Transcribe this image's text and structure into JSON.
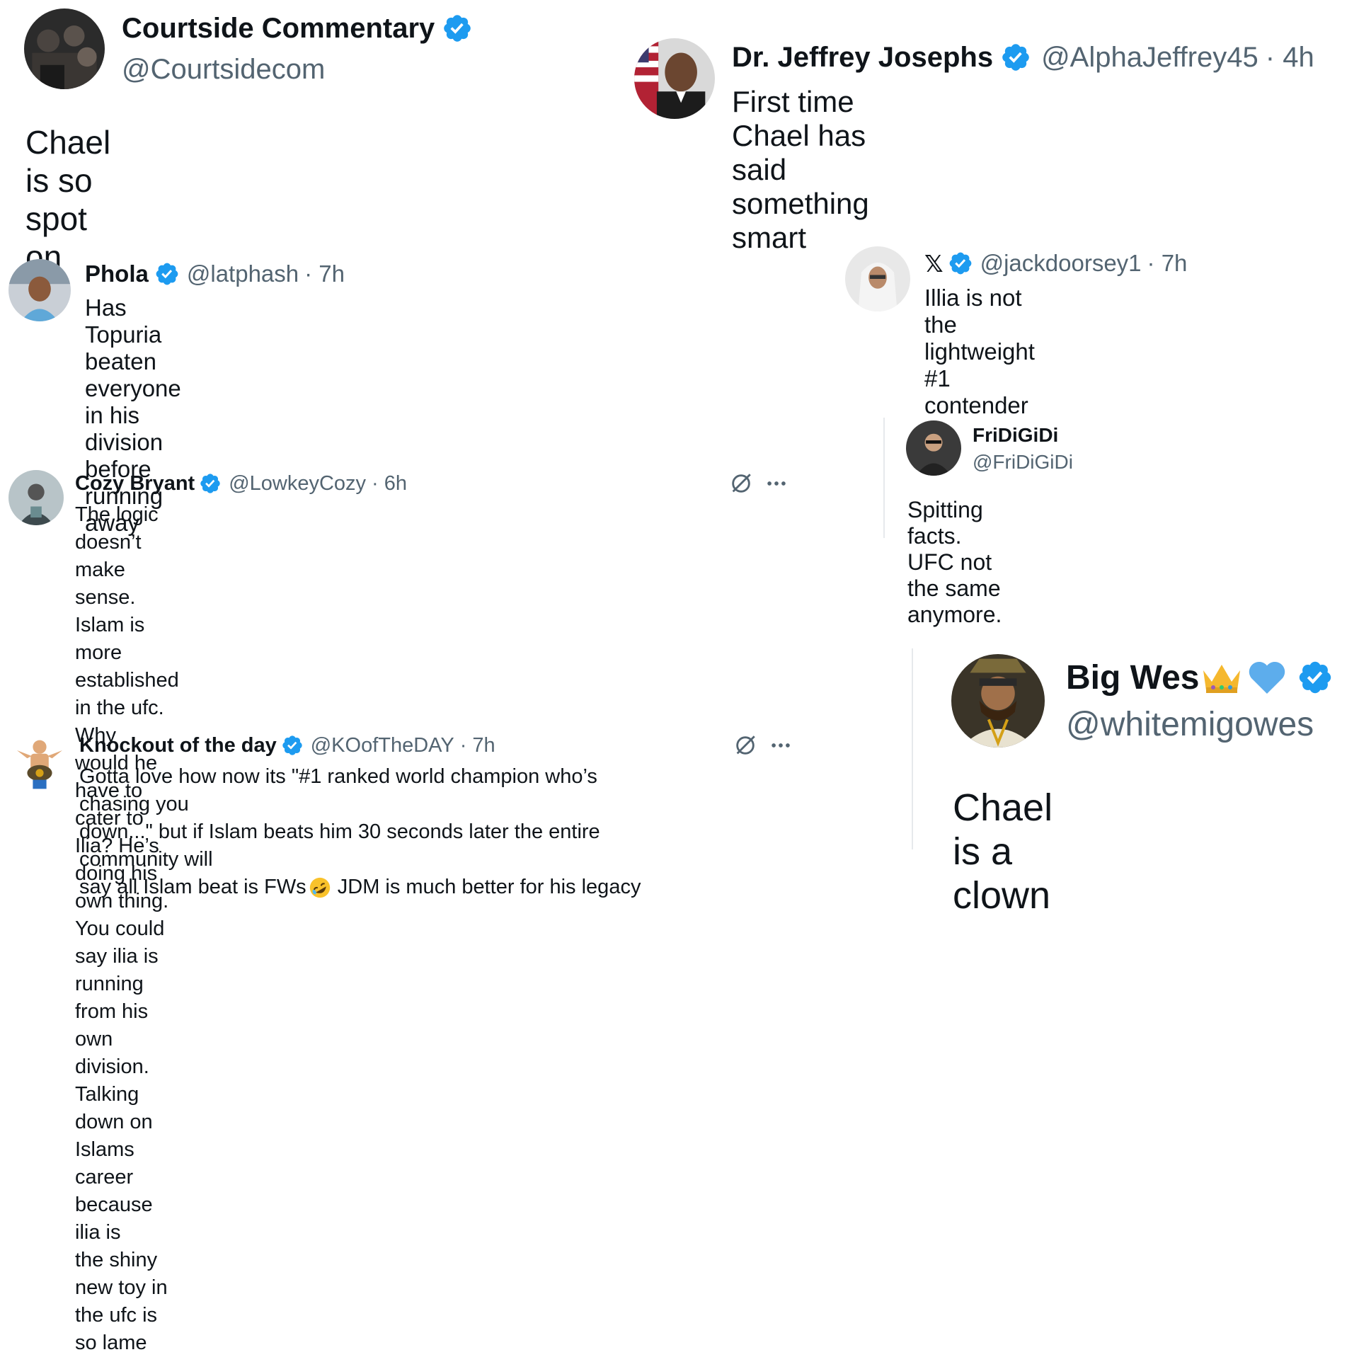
{
  "tweets": [
    {
      "id": "courtside",
      "name": "Courtside Commentary",
      "handle": "@Courtsidecom",
      "text": "Chael is so spot on"
    },
    {
      "id": "jeffrey",
      "name": "Dr. Jeffrey Josephs",
      "handle": "@AlphaJeffrey45",
      "time": "· 4h",
      "text": "First time Chael has said something smart"
    },
    {
      "id": "phola",
      "name": "Phola",
      "handle": "@latphash",
      "time": "· 7h",
      "text": "Has Topuria beaten everyone in his division before running away"
    },
    {
      "id": "jackdoorsey",
      "name": "𝕏",
      "handle": "@jackdoorsey1",
      "time": "· 7h",
      "text": "Illia is not the lightweight #1 contender"
    },
    {
      "id": "fridigidi",
      "name": "FriDiGiDi",
      "handle": "@FriDiGiDi",
      "text": "Spitting facts. UFC not the same anymore."
    },
    {
      "id": "cozy",
      "name": "Cozy Bryant",
      "handle": "@LowkeyCozy",
      "time": "· 6h",
      "lines": [
        "The logic doesn’t make sense. Islam is more established in the ufc. Why",
        "would he have to cater to Ilia? He’s doing his own thing. You could say ilia is",
        "running from his own division. Talking down on Islams career because ilia is",
        "the shiny new toy in the ufc is so lame"
      ]
    },
    {
      "id": "knockout",
      "name": "Knockout of the day",
      "handle": "@KOofTheDAY",
      "time": "· 7h",
      "lines": [
        "Gotta love how now its \"#1 ranked world champion who’s chasing you",
        "down...\" but if Islam beats him 30 seconds later the entire community will",
        "say all Islam beat is FWs"
      ],
      "line3_tail": " JDM is much better for his legacy",
      "emoji": "rolling-on-floor-laughing"
    },
    {
      "id": "bigwes",
      "name": "Big Wes",
      "name_emoji": [
        "crown",
        "blue-heart"
      ],
      "handle": "@whitemigowes",
      "text": "Chael is a clown"
    }
  ],
  "colors": {
    "verified": "#1d9bf0",
    "handle": "#536471",
    "text": "#0f1419",
    "divider": "#e6e9ec"
  },
  "icons": {
    "verified": "verified-badge-icon",
    "grok": "grok-icon",
    "more": "more-options-icon"
  }
}
